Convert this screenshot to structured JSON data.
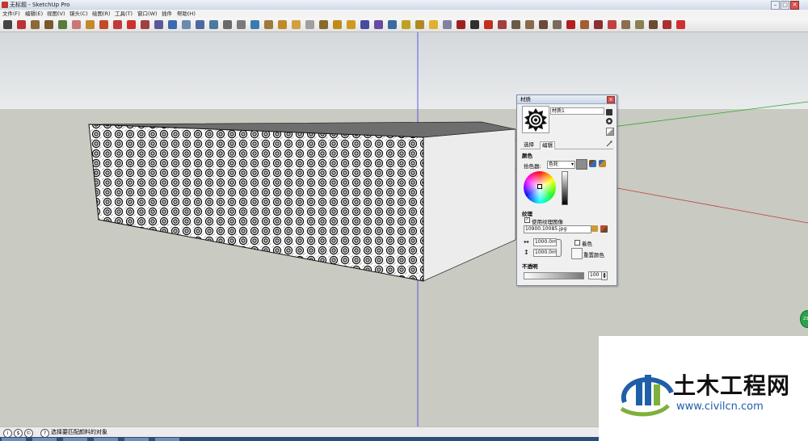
{
  "window": {
    "title": "无标题 - SketchUp Pro",
    "minimize": "–",
    "maximize": "□",
    "close": "✕"
  },
  "menu": [
    "文件(F)",
    "编辑(E)",
    "视图(V)",
    "镜头(C)",
    "绘图(R)",
    "工具(T)",
    "窗口(W)",
    "插件",
    "帮助(H)"
  ],
  "toolbar": {
    "tools": [
      "select-tool",
      "line-tool",
      "rectangle-tool",
      "circle-tool",
      "polygon-tool",
      "eraser-tool",
      "paint-bucket-tool",
      "push-pull-tool",
      "move-tool",
      "rotate-tool",
      "scale-tool",
      "offset-tool",
      "orbit-tool",
      "pan-tool",
      "zoom-tool",
      "zoom-extents-tool",
      "previous-view",
      "components",
      "get-models",
      "share-model",
      "warehouse",
      "extension",
      "styles",
      "xray",
      "back-edges",
      "wireframe",
      "hidden-line",
      "shaded",
      "textured",
      "monochrome",
      "camera-position",
      "walk",
      "look-around",
      "section-plane",
      "section-display",
      "axes",
      "dimensions",
      "protractor",
      "text",
      "3d-text",
      "tape-measure",
      "sandbox-from-contours",
      "sandbox-from-scratch",
      "smoove",
      "stamp",
      "drape",
      "add-detail",
      "flip-edge",
      "photo-textures",
      "instructor"
    ],
    "colors": [
      "#444",
      "#b33",
      "#8a6a3a",
      "#7a5a2c",
      "#5a7a3a",
      "#c77",
      "#c28a2a",
      "#c04a2a",
      "#c03a3a",
      "#cc3030",
      "#a04040",
      "#5a5a9a",
      "#3a6ab0",
      "#6a8ab0",
      "#4a6aa0",
      "#4a7aa0",
      "#6a6a6a",
      "#7a7a7a",
      "#3a7ab0",
      "#a07a3a",
      "#c08a2a",
      "#d0a040",
      "#a0a0a0",
      "#8a6a2a",
      "#c08a1a",
      "#d09a20",
      "#4a4aa0",
      "#6a4aa0",
      "#3a6aa0",
      "#c0a020",
      "#b08a20",
      "#e0b030",
      "#8080a0",
      "#a02020",
      "#303030",
      "#c03020",
      "#a04040",
      "#6a5a4a",
      "#8a6a4a",
      "#6a4a3a",
      "#7a6a5a",
      "#b02020",
      "#a06030",
      "#8a3030",
      "#c04040",
      "#8a7050",
      "#8a8050",
      "#6a4a30",
      "#aa3030",
      "#d03030"
    ]
  },
  "status": {
    "icons": [
      "i",
      "$",
      "©",
      "?"
    ],
    "text": "选择要匹配颜料的对象"
  },
  "material_panel": {
    "title": "材质",
    "close": "×",
    "name": "材质1",
    "tabs": [
      "选择",
      "编辑"
    ],
    "color_section": "颜色",
    "picker_label": "拾色器:",
    "picker_value": "色轮",
    "texture_section": "纹理",
    "use_texture_label": "使用纹理图像",
    "use_texture_checked": true,
    "file_name": "10900.10085.jpg",
    "width_value": "1000.0mm",
    "height_value": "1000.0mm",
    "colorize_label": "着色",
    "reset_color_label": "重置颜色",
    "opacity_section": "不透明",
    "opacity_value": "100"
  },
  "viewport": {
    "badge": "23"
  },
  "watermark": {
    "title": "土木工程网",
    "url": "www.civilcn.com",
    "brand_color": "#1f5fa8"
  }
}
